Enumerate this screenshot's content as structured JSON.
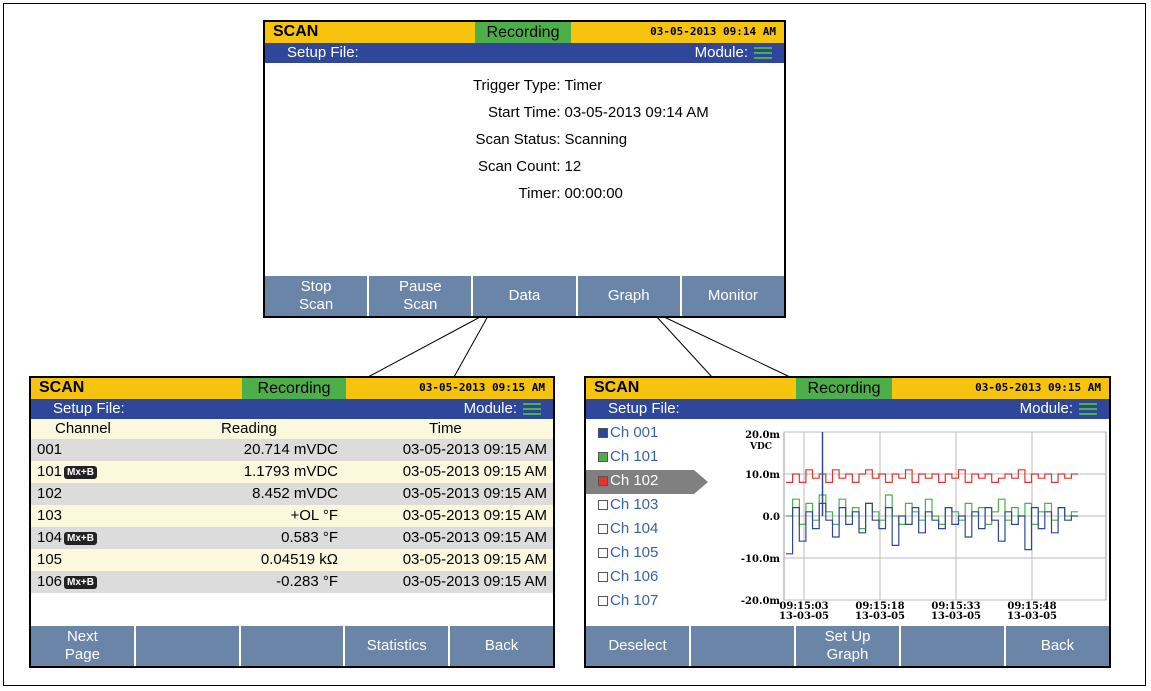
{
  "colors": {
    "title_bar": "#f6c40f",
    "recording": "#4daf4a",
    "subbar": "#2e479b",
    "softkey": "#6a85a8",
    "series_red": "#e8322c",
    "series_green": "#4daf4a",
    "series_blue": "#2e479b"
  },
  "scan_screen": {
    "mode": "SCAN",
    "status": "Recording",
    "datetime": "03-05-2013 09:14 AM",
    "setup_file": "Setup File:",
    "module_label": "Module:",
    "info": [
      {
        "label": "Trigger Type:",
        "value": "Timer"
      },
      {
        "label": "Start Time:",
        "value": "03-05-2013 09:14 AM"
      },
      {
        "label": "Scan Status:",
        "value": "Scanning"
      },
      {
        "label": "Scan Count:",
        "value": "12"
      },
      {
        "label": "Timer:",
        "value": "00:00:00"
      }
    ],
    "softkeys": [
      "Stop\nScan",
      "Pause\nScan",
      "Data",
      "Graph",
      "Monitor"
    ]
  },
  "data_screen": {
    "mode": "SCAN",
    "status": "Recording",
    "datetime": "03-05-2013 09:15 AM",
    "setup_file": "Setup File:",
    "module_label": "Module:",
    "headers": {
      "channel": "Channel",
      "reading": "Reading",
      "time": "Time"
    },
    "mxb_badge": "Mx+B",
    "rows": [
      {
        "channel": "001",
        "mxb": false,
        "reading": "20.714 mVDC",
        "time": "03-05-2013 09:15 AM"
      },
      {
        "channel": "101",
        "mxb": true,
        "reading": "1.1793 mVDC",
        "time": "03-05-2013 09:15 AM"
      },
      {
        "channel": "102",
        "mxb": false,
        "reading": "8.452 mVDC",
        "time": "03-05-2013 09:15 AM"
      },
      {
        "channel": "103",
        "mxb": false,
        "reading": "+OL °F",
        "time": "03-05-2013 09:15 AM"
      },
      {
        "channel": "104",
        "mxb": true,
        "reading": "0.583 °F",
        "time": "03-05-2013 09:15 AM"
      },
      {
        "channel": "105",
        "mxb": false,
        "reading": "0.04519 kΩ",
        "time": "03-05-2013 09:15 AM"
      },
      {
        "channel": "106",
        "mxb": true,
        "reading": "-0.283 °F",
        "time": "03-05-2013 09:15 AM"
      }
    ],
    "softkeys": [
      "Next\nPage",
      "",
      "",
      "Statistics",
      "Back"
    ]
  },
  "graph_screen": {
    "mode": "SCAN",
    "status": "Recording",
    "datetime": "03-05-2013 09:15 AM",
    "setup_file": "Setup File:",
    "module_label": "Module:",
    "channels": [
      {
        "label": "Ch 001",
        "color": "#2e479b",
        "selected": false
      },
      {
        "label": "Ch 101",
        "color": "#4daf4a",
        "selected": false
      },
      {
        "label": "Ch 102",
        "color": "#e8322c",
        "selected": true
      },
      {
        "label": "Ch 103",
        "color": "#ffffff",
        "selected": false
      },
      {
        "label": "Ch 104",
        "color": "#ffffff",
        "selected": false
      },
      {
        "label": "Ch 105",
        "color": "#ffffff",
        "selected": false
      },
      {
        "label": "Ch 106",
        "color": "#ffffff",
        "selected": false
      },
      {
        "label": "Ch 107",
        "color": "#ffffff",
        "selected": false
      }
    ],
    "softkeys": [
      "Deselect",
      "",
      "Set Up\nGraph",
      "",
      "Back"
    ]
  },
  "chart_data": {
    "type": "line",
    "unit": "VDC",
    "ylim": [
      -20,
      20
    ],
    "y_ticks": [
      "20.0m",
      "10.0m",
      "0.0",
      "-10.0m",
      "-20.0m"
    ],
    "x_ticks": [
      {
        "time": "09:15:03",
        "date": "13-03-05"
      },
      {
        "time": "09:15:18",
        "date": "13-03-05"
      },
      {
        "time": "09:15:33",
        "date": "13-03-05"
      },
      {
        "time": "09:15:48",
        "date": "13-03-05"
      }
    ],
    "grid": true,
    "series": [
      {
        "color": "#e8322c",
        "values": [
          8,
          10,
          8,
          11,
          9,
          10,
          8,
          11,
          9,
          10,
          8,
          10,
          11,
          9,
          10,
          8,
          10,
          9,
          11,
          8,
          10,
          9,
          10,
          8,
          10,
          9,
          11,
          8,
          10,
          9,
          10,
          8,
          9,
          10,
          9,
          11,
          8,
          10,
          9,
          10,
          8,
          10,
          9,
          10
        ]
      },
      {
        "color": "#4daf4a",
        "values": [
          0,
          4,
          -2,
          3,
          -1,
          5,
          1,
          -2,
          4,
          0,
          2,
          -3,
          3,
          1,
          -1,
          5,
          0,
          -2,
          3,
          1,
          -1,
          4,
          0,
          -2,
          2,
          1,
          -1,
          3,
          0,
          2,
          -2,
          1,
          4,
          -1,
          2,
          0,
          3,
          -2,
          1,
          3,
          -1,
          2,
          0,
          1
        ]
      },
      {
        "color": "#2e479b",
        "values": [
          -9,
          2,
          -6,
          1,
          -3,
          3,
          -1,
          -5,
          2,
          -2,
          1,
          -4,
          3,
          -1,
          -3,
          2,
          -7,
          0,
          -2,
          2,
          -4,
          1,
          -1,
          -3,
          2,
          -2,
          0,
          -5,
          1,
          -3,
          2,
          -1,
          -6,
          1,
          -2,
          0,
          -8,
          2,
          -3,
          1,
          -4,
          2,
          -1,
          0
        ],
        "spike_index": 5,
        "spike_value": 20
      }
    ]
  }
}
